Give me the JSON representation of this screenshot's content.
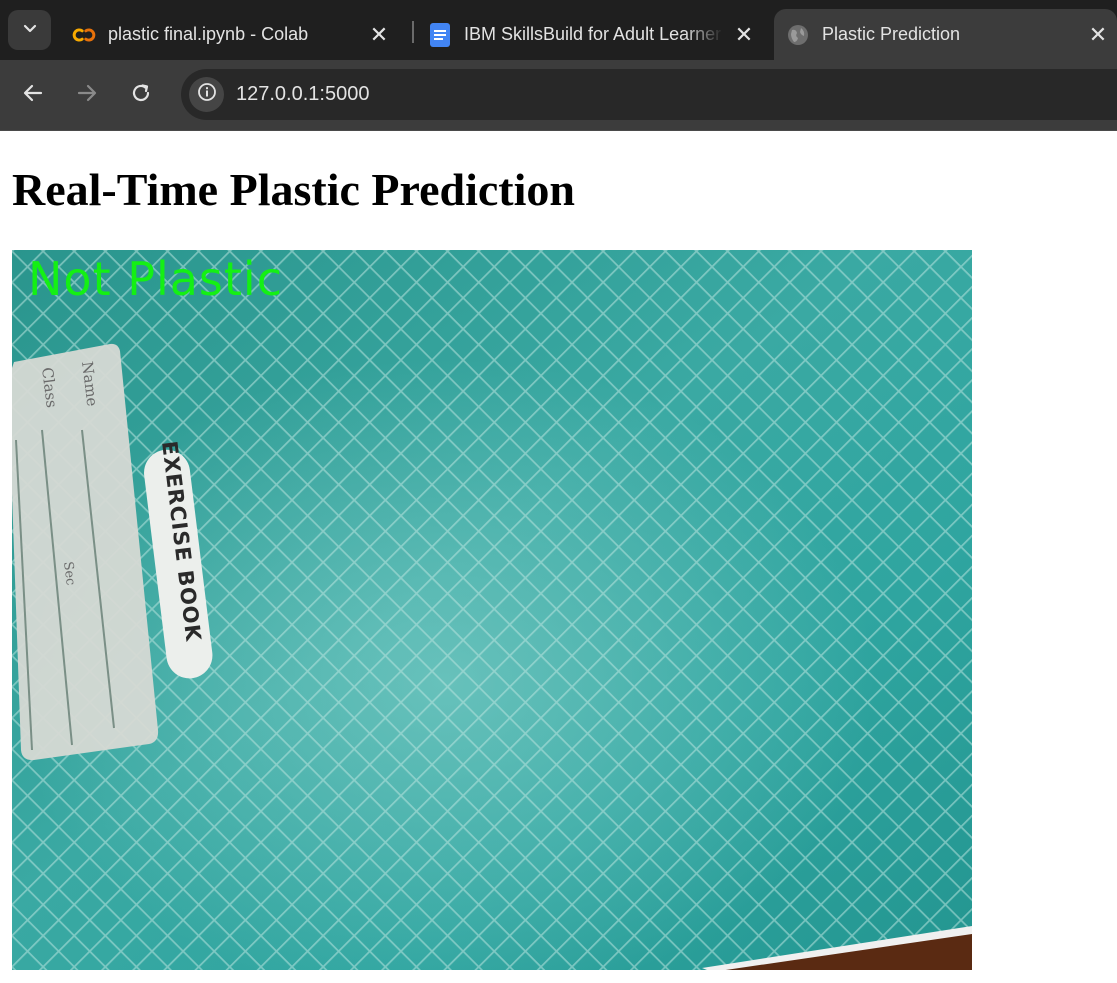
{
  "browser": {
    "tabs": [
      {
        "title": "plastic final.ipynb - Colab",
        "icon": "colab-icon",
        "active": false
      },
      {
        "title": "IBM SkillsBuild for Adult Learner",
        "icon": "docs-icon",
        "active": false
      },
      {
        "title": "Plastic Prediction",
        "icon": "globe-icon",
        "active": true
      }
    ],
    "url": "127.0.0.1:5000"
  },
  "page": {
    "heading": "Real-Time Plastic Prediction",
    "video_feed": {
      "prediction_label": "Not Plastic",
      "label_color": "#14f014",
      "sticker_text": "EXERCISE BOOK",
      "name_label": "Name",
      "class_label": "Class",
      "sec_label": "Sec"
    }
  },
  "colors": {
    "tabstrip_bg": "#1f1f1f",
    "toolbar_bg": "#3c3c3c",
    "feed_teal": "#2e9c96"
  }
}
